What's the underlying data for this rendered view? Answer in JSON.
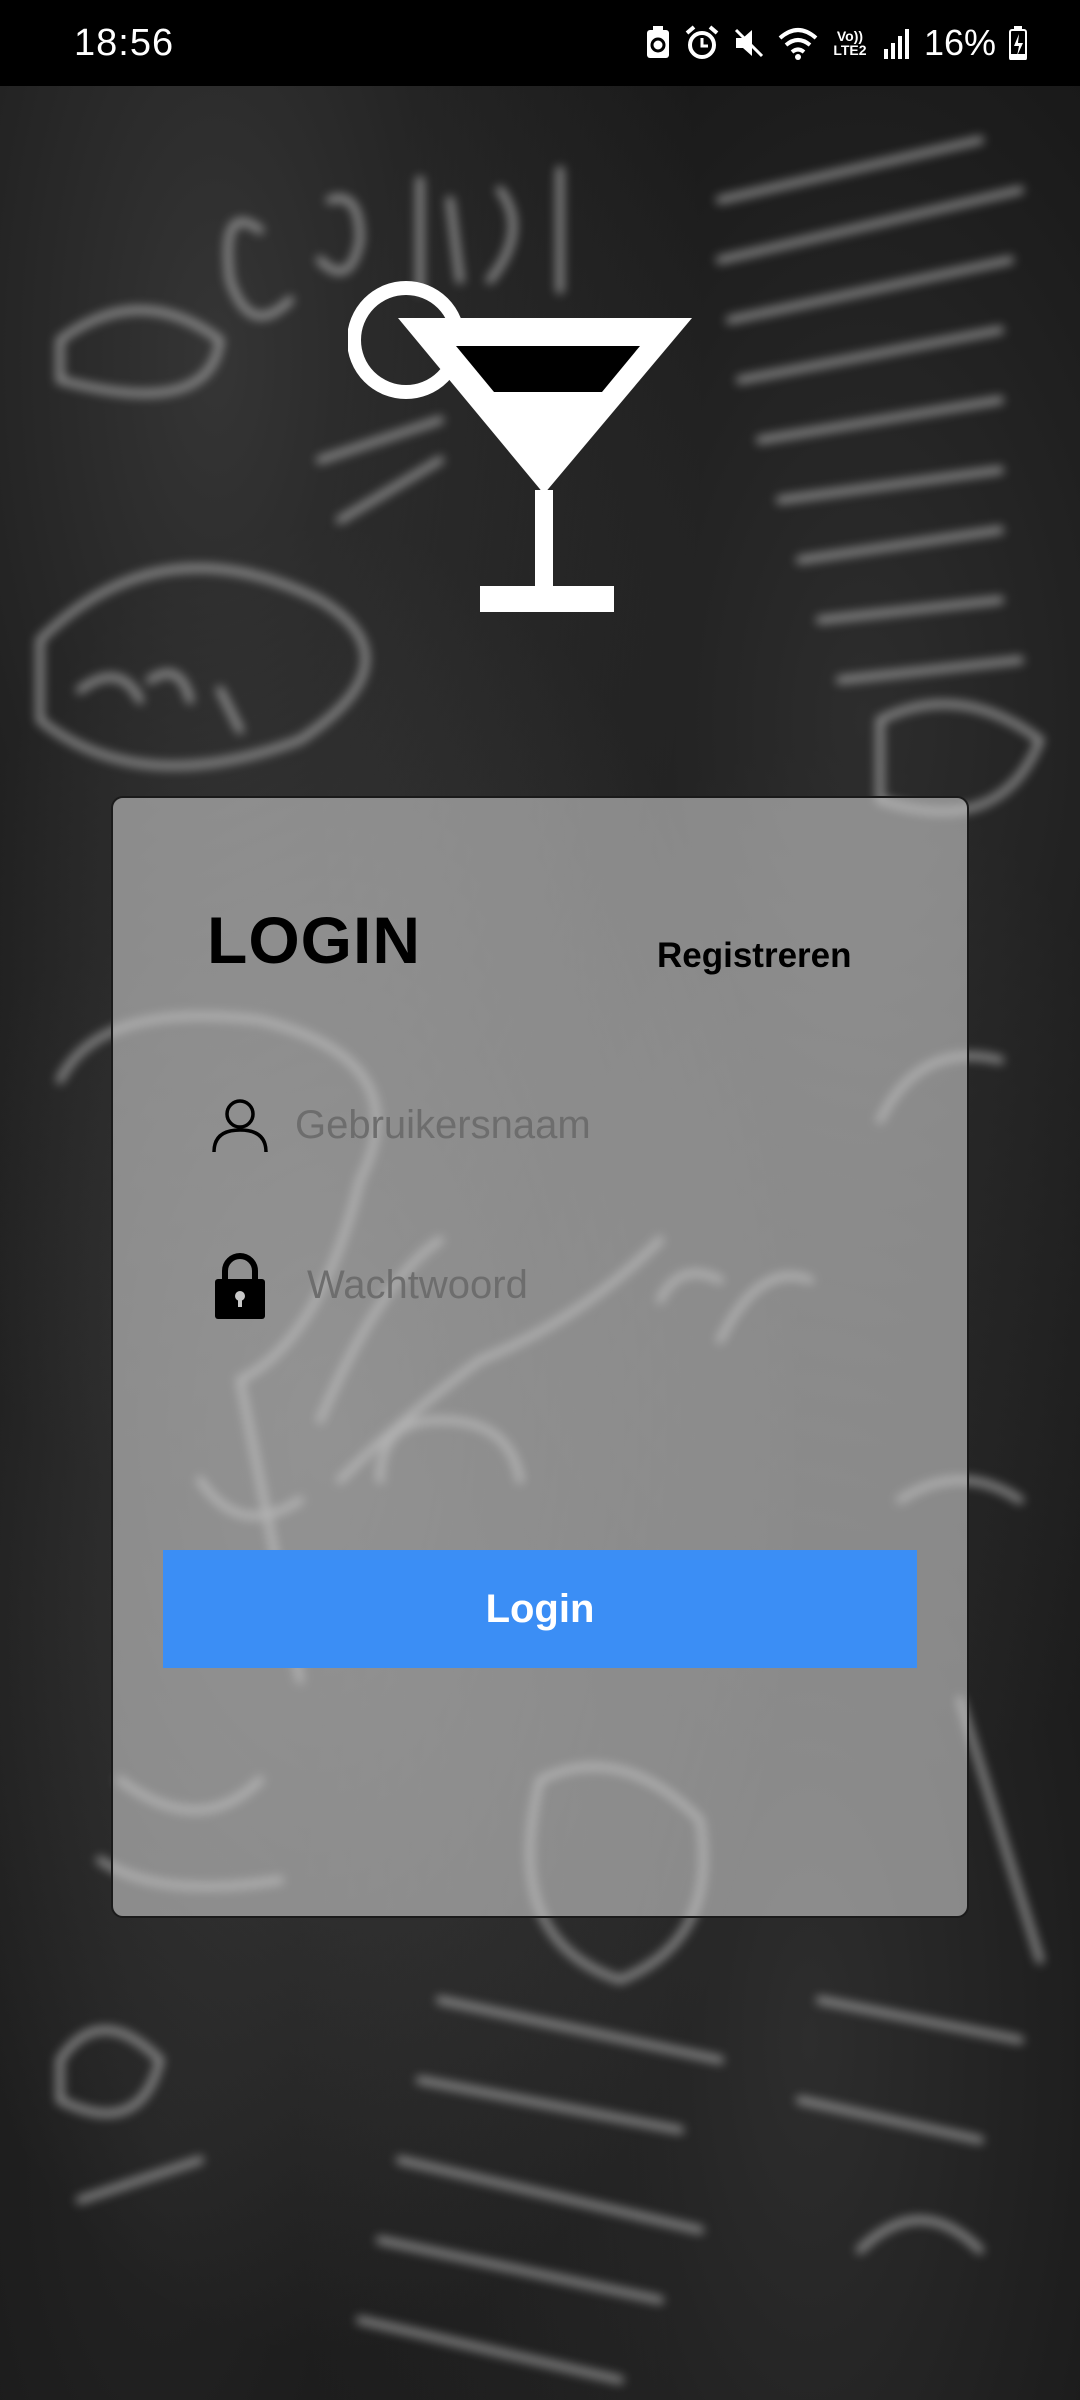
{
  "status_bar": {
    "time": "18:56",
    "network_label": "Vo)) LTE2",
    "battery": "16%",
    "icons": [
      "battery-saver-icon",
      "alarm-icon",
      "mute-icon",
      "wifi-icon",
      "signal-icon",
      "battery-charging-icon"
    ]
  },
  "logo": {
    "icon": "cocktail-glass-icon"
  },
  "login_card": {
    "title": "LOGIN",
    "register_label": "Registreren",
    "username": {
      "placeholder": "Gebruikersnaam",
      "value": "",
      "icon": "user-icon"
    },
    "password": {
      "placeholder": "Wachtwoord",
      "value": "",
      "icon": "lock-icon"
    },
    "submit_label": "Login"
  },
  "colors": {
    "accent": "#3b8ef5",
    "card_bg": "#c8c8c8",
    "status_bar_bg": "#000000",
    "text": "#000000",
    "placeholder": "#6d6d6d"
  }
}
